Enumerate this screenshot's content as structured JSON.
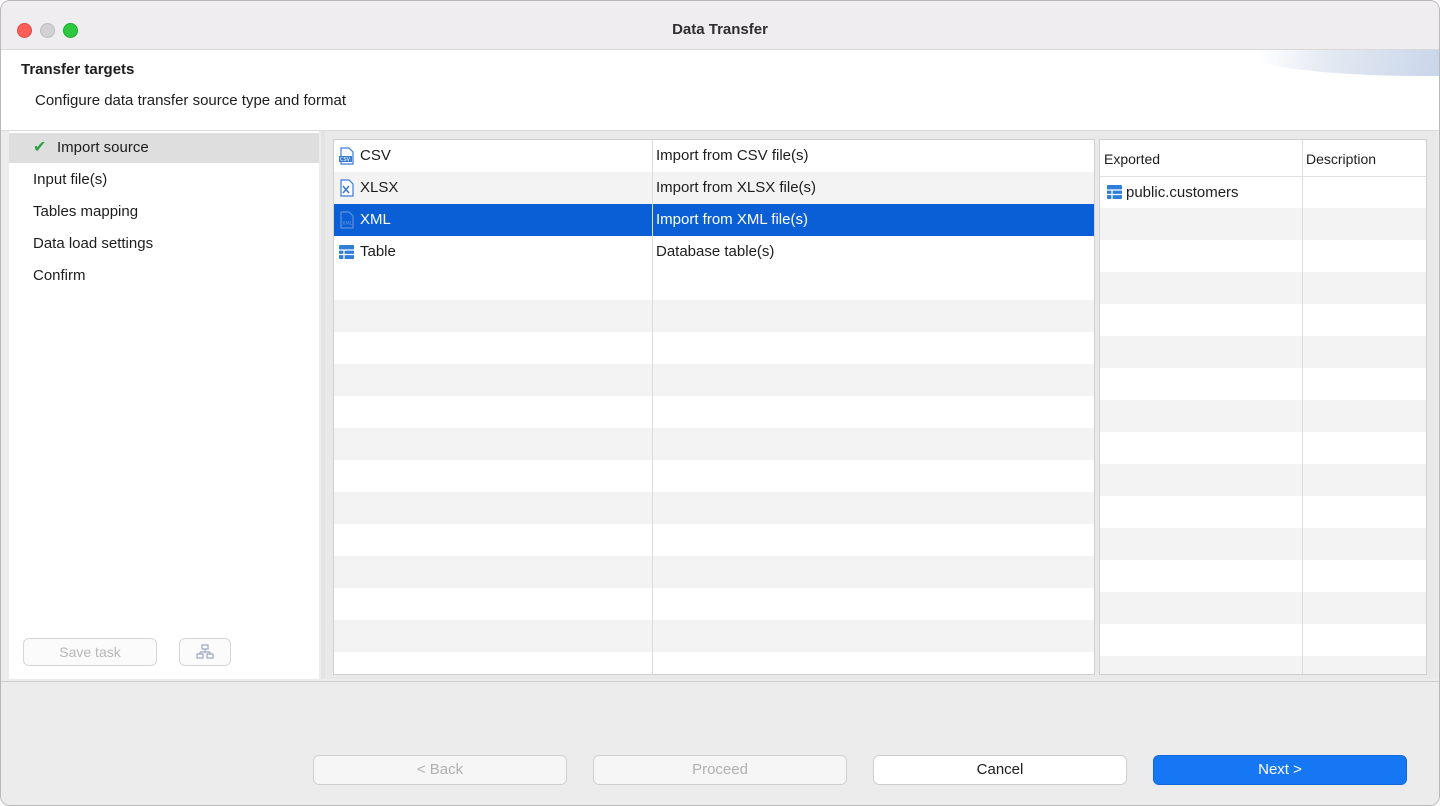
{
  "window": {
    "title": "Data Transfer"
  },
  "header": {
    "title": "Transfer targets",
    "subtitle": "Configure data transfer source type and format"
  },
  "steps": [
    {
      "label": "Import source",
      "selected": true,
      "done": true
    },
    {
      "label": "Input file(s)"
    },
    {
      "label": "Tables mapping"
    },
    {
      "label": "Data load settings"
    },
    {
      "label": "Confirm"
    }
  ],
  "sidebar_buttons": {
    "save_task": "Save task"
  },
  "sources": [
    {
      "name": "CSV",
      "description": "Import from CSV file(s)",
      "icon": "csv-file-icon"
    },
    {
      "name": "XLSX",
      "description": "Import from XLSX file(s)",
      "icon": "xlsx-file-icon"
    },
    {
      "name": "XML",
      "description": "Import from XML file(s)",
      "icon": "xml-file-icon",
      "selected": true
    },
    {
      "name": "Table",
      "description": "Database table(s)",
      "icon": "table-icon"
    }
  ],
  "exported": {
    "headers": [
      "Exported",
      "Description"
    ],
    "rows": [
      {
        "name": "public.customers",
        "description": ""
      }
    ]
  },
  "buttons": {
    "back": "< Back",
    "proceed": "Proceed",
    "cancel": "Cancel",
    "next": "Next >"
  },
  "colors": {
    "selection": "#0a5fd6",
    "primary_button": "#1677f4",
    "check": "#2ea043"
  }
}
